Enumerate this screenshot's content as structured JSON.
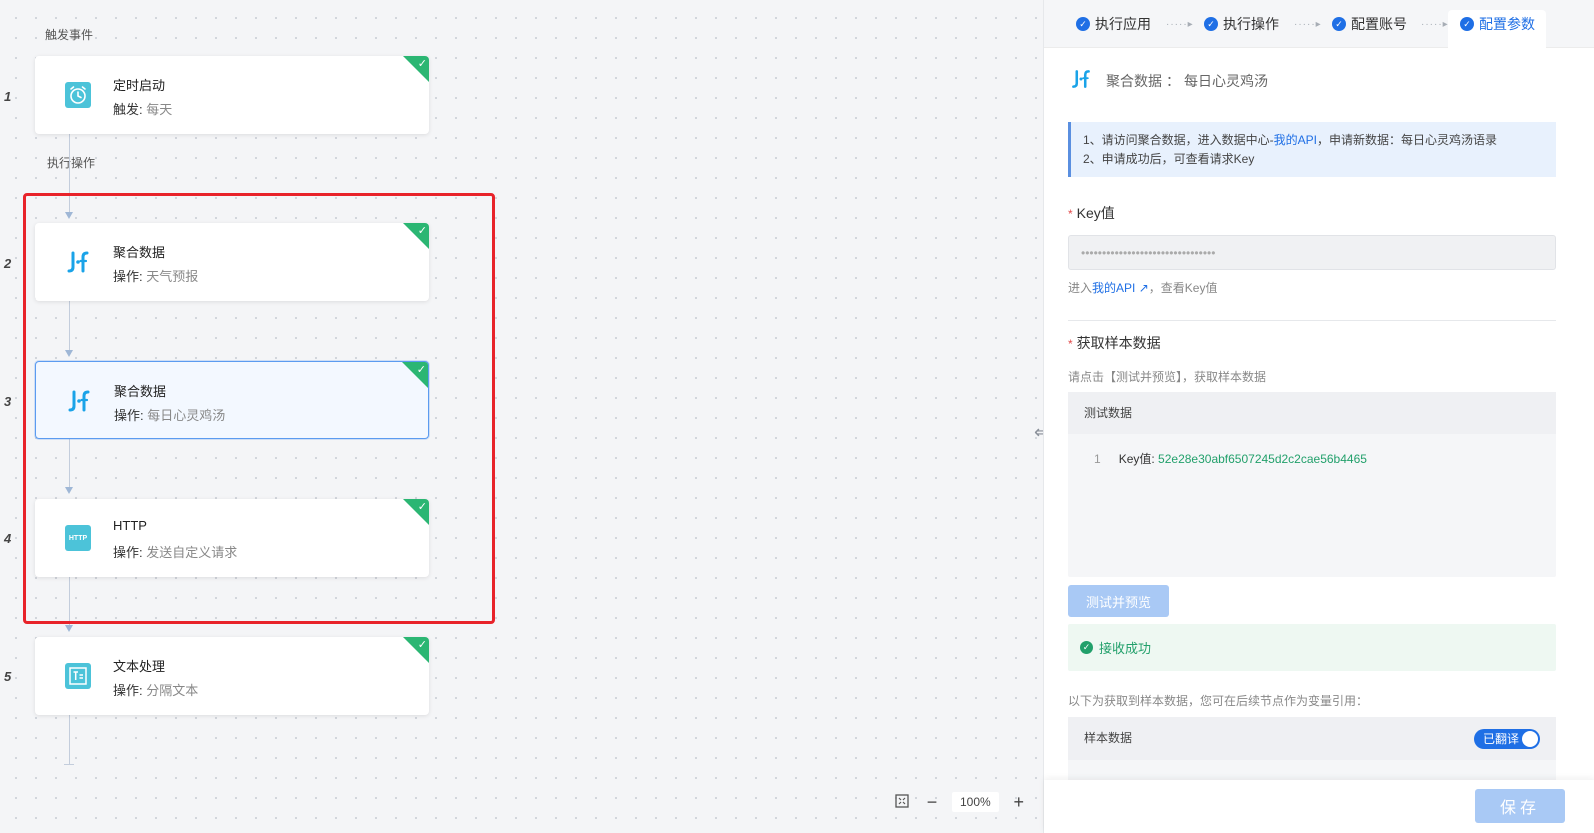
{
  "canvas": {
    "trigger_label": "触发事件",
    "action_label": "执行操作",
    "nodes": [
      {
        "num": "1",
        "title": "定时启动",
        "sub_key": "触发:",
        "sub_val": "每天",
        "icon": "clock-icon"
      },
      {
        "num": "2",
        "title": "聚合数据",
        "sub_key": "操作:",
        "sub_val": "天气预报",
        "icon": "juhe-logo-icon"
      },
      {
        "num": "3",
        "title": "聚合数据",
        "sub_key": "操作:",
        "sub_val": "每日心灵鸡汤",
        "icon": "juhe-logo-icon"
      },
      {
        "num": "4",
        "title": "HTTP",
        "sub_key": "操作:",
        "sub_val": "发送自定义请求",
        "icon": "http-icon",
        "icon_text": "HTTP"
      },
      {
        "num": "5",
        "title": "文本处理",
        "sub_key": "操作:",
        "sub_val": "分隔文本",
        "icon": "text-process-icon"
      }
    ],
    "zoom": "100%"
  },
  "panel": {
    "steps": [
      "执行应用",
      "执行操作",
      "配置账号",
      "配置参数"
    ],
    "step_sep": "·····▸",
    "app_logo": "J·f",
    "app_name": "聚合数据",
    "app_sep": "：",
    "app_action": "每日心灵鸡汤",
    "tip": {
      "line1_pre": "1、请访问聚合数据，进入数据中心-",
      "line1_link": "我的API",
      "line1_post": "，申请新数据：每日心灵鸡汤语录",
      "line2": "2、申请成功后，可查看请求Key"
    },
    "key_label": "Key值",
    "key_value": "••••••••••••••••••••••••••••••••",
    "key_hint_pre": "进入",
    "key_hint_link": "我的API",
    "key_hint_post": "，查看Key值",
    "sample_label": "获取样本数据",
    "sample_hint": "请点击【测试并预览】，获取样本数据",
    "test_head": "测试数据",
    "test_row": {
      "line": "1",
      "key": "Key值:",
      "value": "52e28e30abf6507245d2c2cae56b4465"
    },
    "preview_button": "测试并预览",
    "success_text": "接收成功",
    "sample_desc": "以下为获取到样本数据，您可在后续节点作为变量引用：",
    "sample_head": "样本数据",
    "toggle_label": "已翻译",
    "save_button": "保存"
  },
  "colors": {
    "accent": "#1f6fe5",
    "success": "#22a06b",
    "highlight": "#e8232a",
    "check_badge": "#2bb673"
  }
}
